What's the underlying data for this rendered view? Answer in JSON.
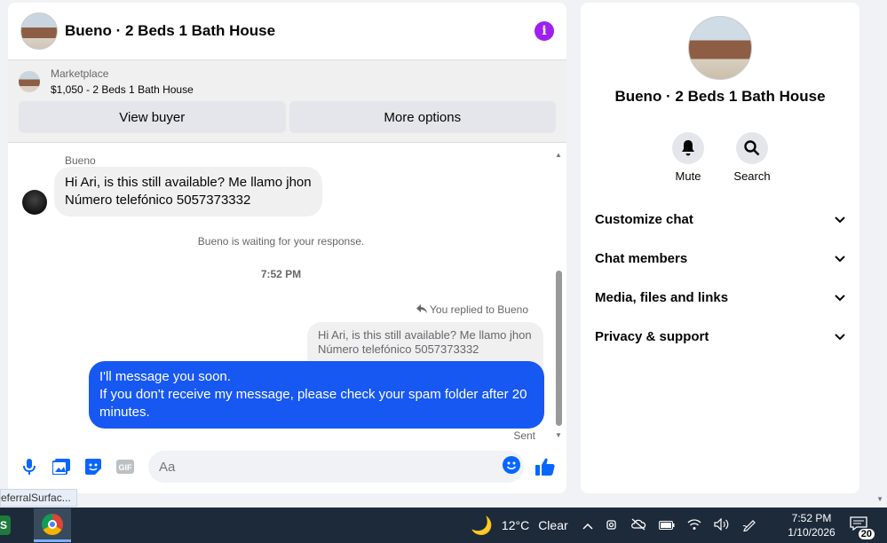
{
  "chat": {
    "title": "Bueno · 2 Beds 1 Bath House",
    "marketplace": {
      "label": "Marketplace",
      "listing": "$1,050 - 2 Beds 1 Bath House",
      "view_buyer": "View buyer",
      "more_options": "More options"
    },
    "messages": {
      "sender_name": "Bueno",
      "incoming_line1": "Hi Ari, is this still available? Me llamo jhon",
      "incoming_line2": "Número  telefónico 5057373332",
      "waiting_notice": "Bueno is waiting for your response.",
      "timestamp": "7:52 PM",
      "replied_label": "You replied to Bueno",
      "quote_line1": "Hi Ari, is this still available? Me llamo jhon",
      "quote_line2": "Número  telefónico 5057373332",
      "outgoing_line1": "I'll message you soon.",
      "outgoing_line2": "If you don't receive my message, please check your spam folder after 20 minutes.",
      "status": "Sent"
    },
    "composer": {
      "placeholder": "Aa",
      "gif_label": "GIF"
    }
  },
  "info_panel": {
    "title": "Bueno · 2 Beds 1 Bath House",
    "actions": [
      {
        "label": "Mute",
        "icon": "bell-icon"
      },
      {
        "label": "Search",
        "icon": "search-icon"
      }
    ],
    "menu": [
      {
        "label": "Customize chat"
      },
      {
        "label": "Chat members"
      },
      {
        "label": "Media, files and links"
      },
      {
        "label": "Privacy & support"
      }
    ]
  },
  "tooltip": "eferralSurfac...",
  "taskbar": {
    "app_letter": "S",
    "weather": "12°C",
    "weather_desc": "Clear",
    "time": "7:52 PM",
    "date": "1/10/2026",
    "notifications": "20"
  },
  "colors": {
    "accent": "#0866ff",
    "outgoing_bubble": "#1758f2",
    "info_icon": "#a020f0",
    "taskbar": "#1c2a3a"
  }
}
